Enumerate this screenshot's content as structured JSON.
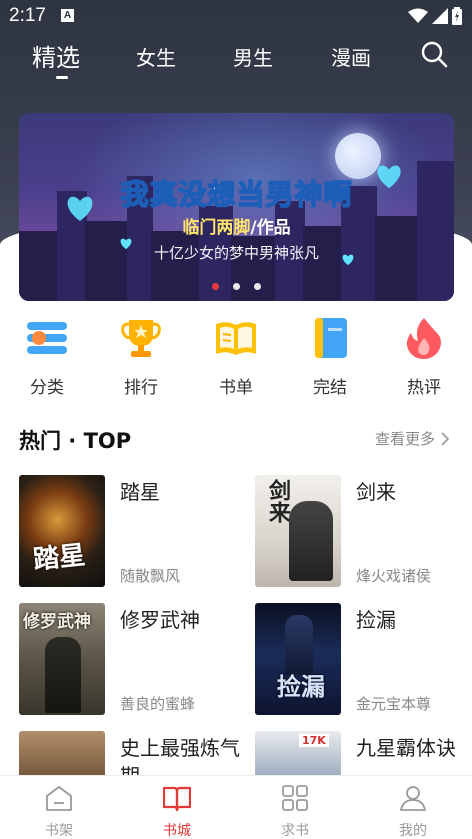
{
  "status_bar": {
    "time": "2:17",
    "notification_badge": "A"
  },
  "top_tabs": [
    {
      "label": "精选",
      "active": true
    },
    {
      "label": "女生",
      "active": false
    },
    {
      "label": "男生",
      "active": false
    },
    {
      "label": "漫画",
      "active": false
    }
  ],
  "search_icon": "search-icon",
  "banner": {
    "title": "我真没想当男神啊",
    "author_name": "临门两脚",
    "author_suffix": "/作品",
    "tagline": "十亿少女的梦中男神张凡",
    "dot_count": 3,
    "active_dot": 0
  },
  "categories": [
    {
      "label": "分类",
      "icon": "category-icon"
    },
    {
      "label": "排行",
      "icon": "trophy-icon"
    },
    {
      "label": "书单",
      "icon": "booklist-icon"
    },
    {
      "label": "完结",
      "icon": "finished-book-icon"
    },
    {
      "label": "热评",
      "icon": "flame-icon"
    }
  ],
  "section": {
    "title": "热门 · TOP",
    "more": "查看更多"
  },
  "books": [
    {
      "title": "踏星",
      "author": "随散飘风",
      "cover_text": "踏星"
    },
    {
      "title": "剑来",
      "author": "烽火戏诸侯",
      "cover_text": "剑来"
    },
    {
      "title": "修罗武神",
      "author": "善良的蜜蜂",
      "cover_text": "修罗武神"
    },
    {
      "title": "捡漏",
      "author": "金元宝本尊",
      "cover_text": "捡漏"
    },
    {
      "title": "史上最强炼气期",
      "author": "",
      "cover_text": ""
    },
    {
      "title": "九星霸体诀",
      "author": "",
      "cover_text": "17K"
    }
  ],
  "bottom_nav": [
    {
      "label": "书架",
      "active": false
    },
    {
      "label": "书城",
      "active": true
    },
    {
      "label": "求书",
      "active": false
    },
    {
      "label": "我的",
      "active": false
    }
  ],
  "colors": {
    "accent": "#e53935",
    "header_bg": "#2e3440"
  }
}
